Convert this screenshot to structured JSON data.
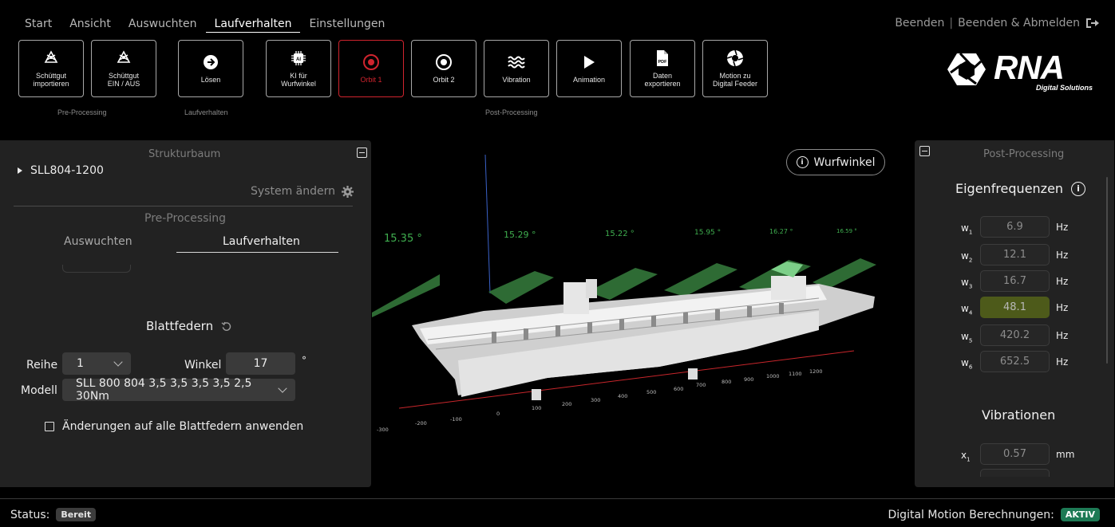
{
  "menu": {
    "items": [
      "Start",
      "Ansicht",
      "Auswuchten",
      "Laufverhalten",
      "Einstellungen"
    ],
    "active": "Laufverhalten"
  },
  "top_right": {
    "quit": "Beenden",
    "separator": "|",
    "quit_logout": "Beenden & Abmelden"
  },
  "toolbar": {
    "buttons": [
      {
        "label": "Schüttgut\nimportieren",
        "icon": "import-bulk-icon"
      },
      {
        "label": "Schüttgut\nEIN / AUS",
        "icon": "toggle-bulk-icon"
      },
      {
        "label": "Lösen",
        "icon": "arrow-right-circle-icon"
      },
      {
        "label": "KI für\nWurfwinkel",
        "icon": "ai-chip-icon"
      },
      {
        "label": "Orbit 1",
        "icon": "orbit-target-icon",
        "active": true
      },
      {
        "label": "Orbit 2",
        "icon": "orbit-target-icon"
      },
      {
        "label": "Vibration",
        "icon": "waves-icon"
      },
      {
        "label": "Animation",
        "icon": "play-icon"
      },
      {
        "label": "Daten\nexportieren",
        "icon": "pdf-file-icon"
      },
      {
        "label": "Motion zu\nDigital Feeder",
        "icon": "aperture-icon"
      }
    ],
    "groups": [
      "Pre-Processing",
      "Laufverhalten",
      "Post-Processing"
    ]
  },
  "logo": {
    "text": "RNA",
    "subtext": "Digital Solutions"
  },
  "left_panel": {
    "title": "Strukturbaum",
    "tree_root": "SLL804-1200",
    "system_change": "System ändern",
    "section_subtitle": "Pre-Processing",
    "tabs": [
      "Auswuchten",
      "Laufverhalten"
    ],
    "active_tab": "Laufverhalten",
    "leaf_springs_title": "Blattfedern",
    "row_label": "Reihe",
    "row_value": "1",
    "angle_label": "Winkel",
    "angle_value": "17",
    "angle_unit": "°",
    "model_label": "Modell",
    "model_value": "SLL 800 804 3,5 3,5 3,5 3,5 2,5 30Nm",
    "apply_all_label": "Änderungen auf alle Blattfedern anwenden",
    "apply_all_checked": false
  },
  "viewport": {
    "angle_labels": [
      "15.35 °",
      "15.29 °",
      "15.22 °",
      "15.95 °",
      "16.27 °",
      "16.59 °"
    ],
    "axis_ticks": [
      "-300",
      "-200",
      "-100",
      "0",
      "100",
      "200",
      "300",
      "400",
      "500",
      "600",
      "700",
      "800",
      "900",
      "1000",
      "1100",
      "1200"
    ],
    "throw_angle_button": "Wurfwinkel",
    "colors": {
      "plate": "#2e6b34",
      "angle_text": "#3fae4f",
      "axis_x": "#c8262b",
      "axis_y": "#3a62c9",
      "machine": "#d9d9d9"
    }
  },
  "right_panel": {
    "title": "Post-Processing",
    "eigen_title": "Eigenfrequenzen",
    "frequencies": [
      {
        "sym": "w",
        "idx": "1",
        "value": "6.9",
        "unit": "Hz"
      },
      {
        "sym": "w",
        "idx": "2",
        "value": "12.1",
        "unit": "Hz"
      },
      {
        "sym": "w",
        "idx": "3",
        "value": "16.7",
        "unit": "Hz"
      },
      {
        "sym": "w",
        "idx": "4",
        "value": "48.1",
        "unit": "Hz",
        "highlight": true
      },
      {
        "sym": "w",
        "idx": "5",
        "value": "420.2",
        "unit": "Hz"
      },
      {
        "sym": "w",
        "idx": "6",
        "value": "652.5",
        "unit": "Hz"
      }
    ],
    "vibration_title": "Vibrationen",
    "vibrations": [
      {
        "sym": "x",
        "idx": "1",
        "value": "0.57",
        "unit": "mm"
      }
    ]
  },
  "status": {
    "label": "Status:",
    "value": "Bereit",
    "digital_motion_label": "Digital Motion Berechnungen:",
    "digital_motion_value": "AKTIV"
  }
}
